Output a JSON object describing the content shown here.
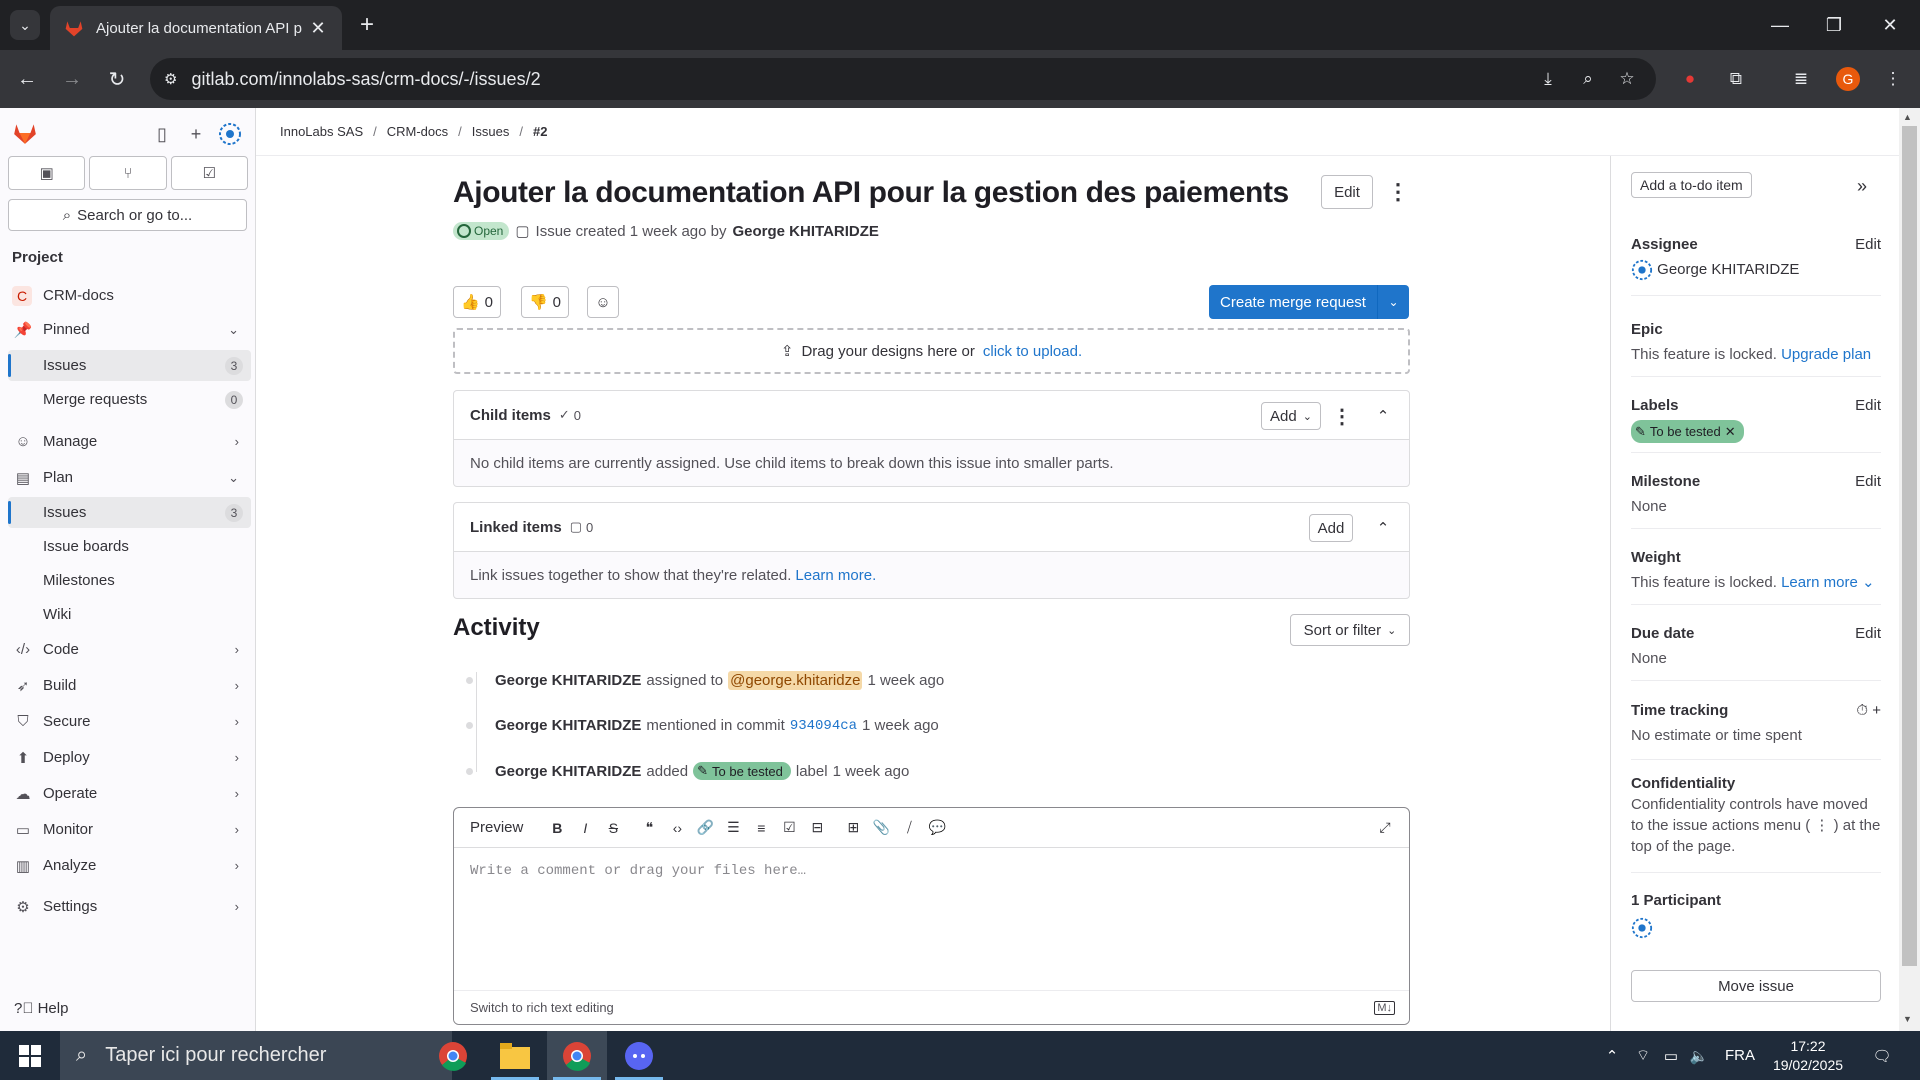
{
  "browser": {
    "tab_title": "Ajouter la documentation API p",
    "url": "gitlab.com/innolabs-sas/crm-docs/-/issues/2",
    "profile_initial": "G"
  },
  "sidebar": {
    "search_label": "Search or go to...",
    "section_label": "Project",
    "project_badge": "C",
    "project_name": "CRM-docs",
    "pinned_label": "Pinned",
    "pinned_items": [
      {
        "label": "Issues",
        "count": "3"
      },
      {
        "label": "Merge requests",
        "count": "0"
      }
    ],
    "manage_label": "Manage",
    "plan_label": "Plan",
    "plan_items": [
      {
        "label": "Issues",
        "count": "3"
      },
      {
        "label": "Issue boards"
      },
      {
        "label": "Milestones"
      },
      {
        "label": "Wiki"
      }
    ],
    "groups": [
      "Code",
      "Build",
      "Secure",
      "Deploy",
      "Operate",
      "Monitor",
      "Analyze",
      "Settings"
    ],
    "help_label": "Help"
  },
  "breadcrumb": {
    "items": [
      "InnoLabs SAS",
      "CRM-docs",
      "Issues",
      "#2"
    ]
  },
  "issue": {
    "title": "Ajouter la documentation API pour la gestion des paiements",
    "edit_label": "Edit",
    "status": "Open",
    "created_text": "Issue created 1 week ago by",
    "author": "George KHITARIDZE",
    "thumbs_up": "0",
    "thumbs_down": "0",
    "create_mr_label": "Create merge request",
    "dropzone_text": "Drag your designs here or",
    "dropzone_link": "click to upload."
  },
  "child_items": {
    "title": "Child items",
    "count": "0",
    "add_label": "Add",
    "empty_text": "No child items are currently assigned. Use child items to break down this issue into smaller parts."
  },
  "linked_items": {
    "title": "Linked items",
    "count": "0",
    "add_label": "Add",
    "empty_text": "Link issues together to show that they're related.",
    "learn_more": "Learn more."
  },
  "activity": {
    "title": "Activity",
    "sort_label": "Sort or filter",
    "notes": [
      {
        "author": "George KHITARIDZE",
        "text1": "assigned to",
        "mention": "@george.khitaridze",
        "time": "1 week ago"
      },
      {
        "author": "George KHITARIDZE",
        "text1": "mentioned in commit",
        "commit": "934094ca",
        "time": "1 week ago"
      },
      {
        "author": "George KHITARIDZE",
        "text1": "added",
        "label": "To be tested",
        "text2": "label",
        "time": "1 week ago"
      }
    ]
  },
  "editor": {
    "preview_label": "Preview",
    "placeholder": "Write a comment or drag your files here…",
    "footer_label": "Switch to rich text editing"
  },
  "right_sidebar": {
    "todo_label": "Add a to-do item",
    "assignee_title": "Assignee",
    "assignee_edit": "Edit",
    "assignee_name": "George KHITARIDZE",
    "epic_title": "Epic",
    "epic_text": "This feature is locked.",
    "epic_link": "Upgrade plan",
    "labels_title": "Labels",
    "labels_edit": "Edit",
    "label_value": "To be tested",
    "milestone_title": "Milestone",
    "milestone_edit": "Edit",
    "milestone_value": "None",
    "weight_title": "Weight",
    "weight_text": "This feature is locked.",
    "weight_link": "Learn more",
    "due_title": "Due date",
    "due_edit": "Edit",
    "due_value": "None",
    "time_title": "Time tracking",
    "time_value": "No estimate or time spent",
    "conf_title": "Confidentiality",
    "conf_text": "Confidentiality controls have moved to the issue actions menu ( ⋮ ) at the top of the page.",
    "participants_title": "1 Participant",
    "move_label": "Move issue"
  },
  "taskbar": {
    "search_placeholder": "Taper ici pour rechercher",
    "lang": "FRA",
    "time": "17:22",
    "date": "19/02/2025"
  },
  "colors": {
    "accent": "#1f75cb",
    "label_green": "#7fc39a",
    "open_badge": "#c3e6cd",
    "browser_dark": "#202124"
  }
}
